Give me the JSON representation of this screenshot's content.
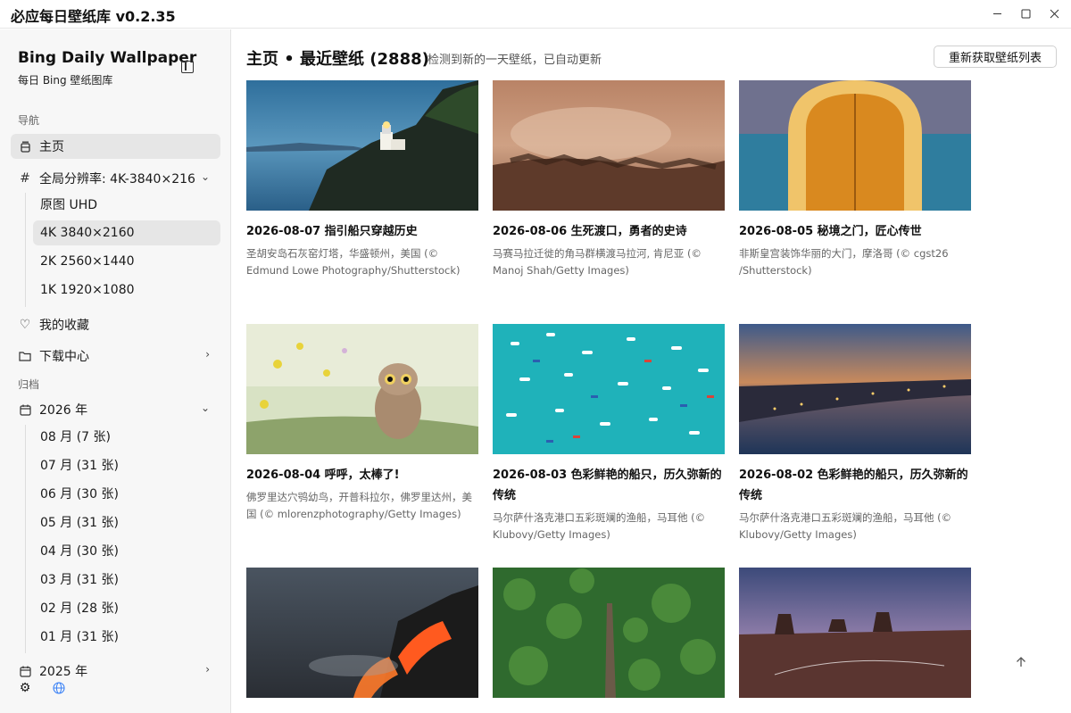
{
  "window": {
    "title": "必应每日壁纸库 v0.2.35",
    "minimize": "—",
    "maximize": "☐",
    "close": "✕"
  },
  "sidebar": {
    "brand_title": "Bing Daily Wallpaper",
    "brand_subtitle": "每日 Bing 壁纸图库",
    "nav_label": "导航",
    "home": "主页",
    "resolution": "全局分辨率: 4K-3840×216",
    "resolutions": [
      "原图 UHD",
      "4K 3840×2160",
      "2K 2560×1440",
      "1K 1920×1080"
    ],
    "favorites": "我的收藏",
    "downloads": "下载中心",
    "archive_label": "归档",
    "year_2026": "2026 年",
    "months": [
      "08 月 (7 张)",
      "07 月 (31 张)",
      "06 月 (30 张)",
      "05 月 (31 张)",
      "04 月 (30 张)",
      "03 月 (31 张)",
      "02 月 (28 张)",
      "01 月 (31 张)"
    ],
    "year_2025": "2025 年"
  },
  "main": {
    "title": "主页 • 最近壁纸 (2888)",
    "notice": "检测到新的一天壁纸，已自动更新",
    "refresh_button": "重新获取壁纸列表"
  },
  "cards": [
    {
      "title": "2026-08-07 指引船只穿越历史",
      "desc": "圣胡安岛石灰窑灯塔，华盛顿州，美国 (© Edmund Lowe Photography/Shutterstock)"
    },
    {
      "title": "2026-08-06 生死渡口，勇者的史诗",
      "desc": "马赛马拉迁徙的角马群横渡马拉河, 肯尼亚 (© Manoj Shah/Getty Images)"
    },
    {
      "title": "2026-08-05 秘境之门，匠心传世",
      "desc": "非斯皇宫装饰华丽的大门，摩洛哥 (© cgst26 /Shutterstock)"
    },
    {
      "title": "2026-08-04 呼呼，太棒了!",
      "desc": "佛罗里达穴鸮幼鸟，开普科拉尔，佛罗里达州，美国 (© mlorenzphotography/Getty Images)"
    },
    {
      "title": "2026-08-03 色彩鲜艳的船只，历久弥新的传统",
      "desc": "马尔萨什洛克港口五彩斑斓的渔船，马耳他 (© Klubovy/Getty Images)"
    },
    {
      "title": "2026-08-02 色彩鲜艳的船只，历久弥新的传统",
      "desc": "马尔萨什洛克港口五彩斑斓的渔船，马耳他 (© Klubovy/Getty Images)"
    },
    {
      "title": "",
      "desc": ""
    },
    {
      "title": "",
      "desc": ""
    },
    {
      "title": "",
      "desc": ""
    }
  ],
  "icons": {
    "home": "home-icon",
    "resolution": "hash-icon",
    "favorites": "heart-icon",
    "downloads": "folder-icon",
    "calendar": "calendar-icon",
    "settings": "gear-icon",
    "language": "globe-icon",
    "back_to_top": "arrow-up-icon"
  }
}
